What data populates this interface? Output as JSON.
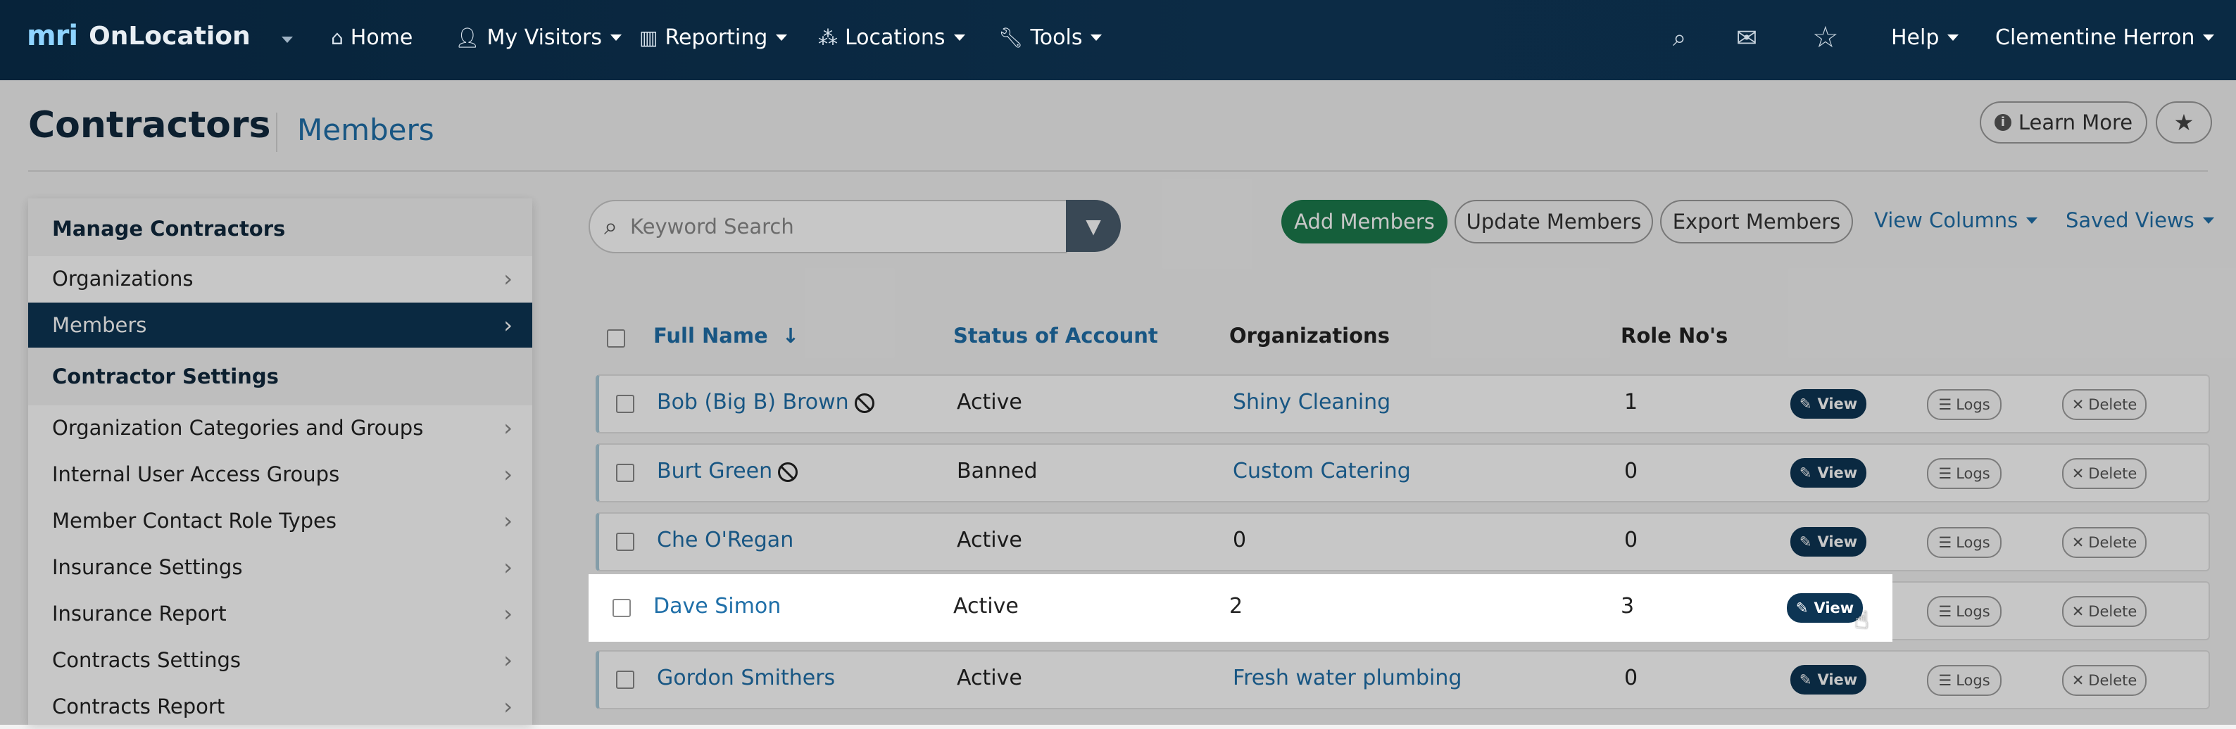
{
  "topnav": {
    "brand_logo": "mri",
    "brand_name": "OnLocation",
    "items": [
      {
        "label": "Home",
        "icon": "home-icon"
      },
      {
        "label": "My Visitors",
        "icon": "user-icon"
      },
      {
        "label": "Reporting",
        "icon": "bar-chart-icon"
      },
      {
        "label": "Locations",
        "icon": "network-icon"
      },
      {
        "label": "Tools",
        "icon": "wrench-icon"
      }
    ],
    "help": "Help",
    "user": "Clementine Herron"
  },
  "header": {
    "title": "Contractors",
    "subtitle": "Members",
    "learn_more": "Learn More"
  },
  "sidebar": {
    "section1": "Manage Contractors",
    "section1_items": [
      "Organizations",
      "Members"
    ],
    "section2": "Contractor Settings",
    "section2_items": [
      "Organization Categories and Groups",
      "Internal User Access Groups",
      "Member Contact Role Types",
      "Insurance Settings",
      "Insurance Report",
      "Contracts Settings",
      "Contracts Report"
    ]
  },
  "toolbar": {
    "search_placeholder": "Keyword Search",
    "add": "Add Members",
    "update": "Update Members",
    "export": "Export Members",
    "view_columns": "View Columns",
    "saved_views": "Saved Views"
  },
  "table": {
    "headers": {
      "name": "Full Name",
      "sort_arrow": "↓",
      "status": "Status of Account",
      "orgs": "Organizations",
      "roles": "Role No's"
    },
    "actions": {
      "view": "View",
      "logs": "Logs",
      "delete": "Delete"
    },
    "rows": [
      {
        "name": "Bob (Big B) Brown",
        "banned_icon": true,
        "status": "Active",
        "org": "Shiny Cleaning",
        "org_link": true,
        "roles": "1"
      },
      {
        "name": "Burt Green",
        "banned_icon": true,
        "status": "Banned",
        "org": "Custom Catering",
        "org_link": true,
        "roles": "0"
      },
      {
        "name": "Che O'Regan",
        "banned_icon": false,
        "status": "Active",
        "org": "0",
        "org_link": false,
        "roles": "0"
      },
      {
        "name": "Dave Simon",
        "banned_icon": false,
        "status": "Active",
        "org": "2",
        "org_link": false,
        "roles": "3"
      },
      {
        "name": "Gordon Smithers",
        "banned_icon": false,
        "status": "Active",
        "org": "Fresh water plumbing",
        "org_link": true,
        "roles": "0"
      }
    ]
  },
  "colors": {
    "nav_bg": "#0a2a44",
    "accent_link": "#1f6fa8",
    "primary_dark": "#0d3554",
    "green": "#1b7a4c"
  }
}
